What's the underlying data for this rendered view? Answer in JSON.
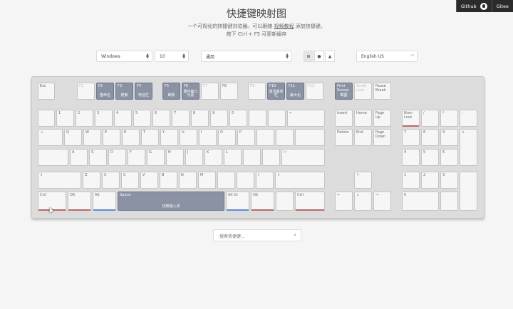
{
  "links": {
    "github": "Github",
    "gitee": "Gitee"
  },
  "title": "快捷键映射图",
  "subtitle1_pre": "一个可视化的快捷键浏览器。可以跟随 ",
  "subtitle1_link": "视频教程",
  "subtitle1_post": " 添加快捷键。",
  "subtitle2": "按下 Ctrl + F5 可更新缓存",
  "controls": {
    "os": "Windows",
    "version": "10",
    "app": "通用",
    "lang": "English US",
    "os_icons": [
      "windows-icon",
      "apple-icon",
      "linux-icon"
    ]
  },
  "keys": [
    {
      "l": "Esc",
      "a": ""
    },
    {
      "l": "F1",
      "a": ""
    },
    {
      "l": "F2",
      "a": "重命名"
    },
    {
      "l": "F3",
      "a": "搜索"
    },
    {
      "l": "F4",
      "a": "地址栏"
    },
    {
      "l": "F5",
      "a": "刷新"
    },
    {
      "l": "F6",
      "a": "循环窗口元素"
    },
    {
      "l": "F7",
      "a": ""
    },
    {
      "l": "F8",
      "a": ""
    },
    {
      "l": "F9",
      "a": ""
    },
    {
      "l": "F10",
      "a": "激活菜单栏"
    },
    {
      "l": "F11",
      "a": "最大化"
    },
    {
      "l": "F12",
      "a": ""
    },
    {
      "l": "Print Screen",
      "a": "截图"
    },
    {
      "l": "Scroll Lock",
      "a": ""
    },
    {
      "l": "Pause Break",
      "a": ""
    },
    {
      "l": "",
      "a": ""
    },
    {
      "l": "1",
      "a": ""
    },
    {
      "l": "2",
      "a": ""
    },
    {
      "l": "3",
      "a": ""
    },
    {
      "l": "4",
      "a": ""
    },
    {
      "l": "5",
      "a": ""
    },
    {
      "l": "6",
      "a": ""
    },
    {
      "l": "7",
      "a": ""
    },
    {
      "l": "8",
      "a": ""
    },
    {
      "l": "9",
      "a": ""
    },
    {
      "l": "0",
      "a": ""
    },
    {
      "l": "",
      "a": ""
    },
    {
      "l": "",
      "a": ""
    },
    {
      "l": "←",
      "a": ""
    },
    {
      "l": "Insert",
      "a": ""
    },
    {
      "l": "Home",
      "a": ""
    },
    {
      "l": "Page Up",
      "a": ""
    },
    {
      "l": "Num Lock",
      "a": ""
    },
    {
      "l": "/",
      "a": ""
    },
    {
      "l": "*",
      "a": ""
    },
    {
      "l": "-",
      "a": ""
    },
    {
      "l": "→",
      "a": ""
    },
    {
      "l": "Q",
      "a": ""
    },
    {
      "l": "W",
      "a": ""
    },
    {
      "l": "E",
      "a": ""
    },
    {
      "l": "R",
      "a": ""
    },
    {
      "l": "T",
      "a": ""
    },
    {
      "l": "Y",
      "a": ""
    },
    {
      "l": "U",
      "a": ""
    },
    {
      "l": "I",
      "a": ""
    },
    {
      "l": "O",
      "a": ""
    },
    {
      "l": "P",
      "a": ""
    },
    {
      "l": "",
      "a": ""
    },
    {
      "l": "",
      "a": ""
    },
    {
      "l": "",
      "a": ""
    },
    {
      "l": "Delete",
      "a": ""
    },
    {
      "l": "End",
      "a": ""
    },
    {
      "l": "Page Down",
      "a": ""
    },
    {
      "l": "7",
      "a": ""
    },
    {
      "l": "8",
      "a": ""
    },
    {
      "l": "9",
      "a": ""
    },
    {
      "l": "+",
      "a": ""
    },
    {
      "l": "",
      "a": ""
    },
    {
      "l": "A",
      "a": ""
    },
    {
      "l": "S",
      "a": ""
    },
    {
      "l": "D",
      "a": ""
    },
    {
      "l": "F",
      "a": ""
    },
    {
      "l": "G",
      "a": ""
    },
    {
      "l": "H",
      "a": ""
    },
    {
      "l": "J",
      "a": ""
    },
    {
      "l": "K",
      "a": ""
    },
    {
      "l": "L",
      "a": ""
    },
    {
      "l": "",
      "a": ""
    },
    {
      "l": "",
      "a": ""
    },
    {
      "l": "↵",
      "a": ""
    },
    {
      "l": "4",
      "a": ""
    },
    {
      "l": "5",
      "a": ""
    },
    {
      "l": "6",
      "a": ""
    },
    {
      "l": "⇧",
      "a": ""
    },
    {
      "l": "Z",
      "a": ""
    },
    {
      "l": "X",
      "a": ""
    },
    {
      "l": "C",
      "a": ""
    },
    {
      "l": "V",
      "a": ""
    },
    {
      "l": "B",
      "a": ""
    },
    {
      "l": "N",
      "a": ""
    },
    {
      "l": "M",
      "a": ""
    },
    {
      "l": "",
      "a": ""
    },
    {
      "l": "",
      "a": ""
    },
    {
      "l": "/",
      "a": ""
    },
    {
      "l": "⇧",
      "a": ""
    },
    {
      "l": "↑",
      "a": ""
    },
    {
      "l": "1",
      "a": ""
    },
    {
      "l": "2",
      "a": ""
    },
    {
      "l": "3",
      "a": ""
    },
    {
      "l": "",
      "a": ""
    },
    {
      "l": "Ctrl",
      "a": ""
    },
    {
      "l": "OS",
      "a": ""
    },
    {
      "l": "Alt",
      "a": ""
    },
    {
      "l": "Space",
      "a": "切换输入法"
    },
    {
      "l": "Alt Gr",
      "a": ""
    },
    {
      "l": "OS",
      "a": ""
    },
    {
      "l": "",
      "a": ""
    },
    {
      "l": "Ctrl",
      "a": ""
    },
    {
      "l": "←",
      "a": ""
    },
    {
      "l": "↓",
      "a": ""
    },
    {
      "l": "→",
      "a": ""
    },
    {
      "l": "0",
      "a": ""
    },
    {
      "l": "",
      "a": ""
    }
  ],
  "search_placeholder": "搜索快捷键..."
}
